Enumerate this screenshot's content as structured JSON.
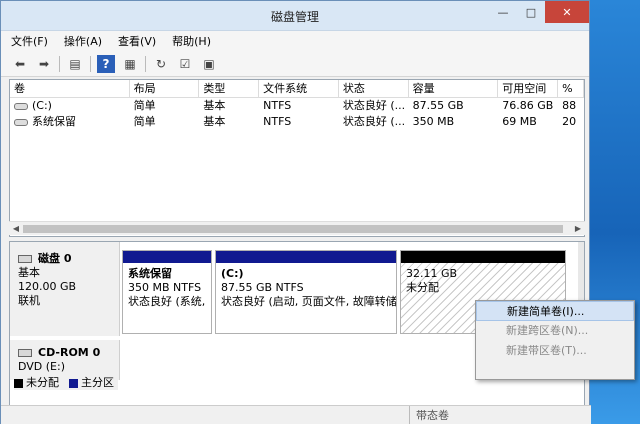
{
  "window": {
    "title": "磁盘管理"
  },
  "window_buttons": {
    "minimize": "—",
    "maximize": "□",
    "close": "✕"
  },
  "menu": [
    "文件(F)",
    "操作(A)",
    "查看(V)",
    "帮助(H)"
  ],
  "toolbar_icons": [
    "back-arrow-icon",
    "forward-arrow-icon",
    "list-view-icon",
    "help-icon",
    "properties-icon",
    "refresh-icon",
    "export-icon",
    "settings-icon"
  ],
  "volume_list": {
    "columns": [
      "卷",
      "布局",
      "类型",
      "文件系统",
      "状态",
      "容量",
      "可用空间",
      "%"
    ],
    "rows": [
      [
        "(C:)",
        "简单",
        "基本",
        "NTFS",
        "状态良好 (...",
        "87.55 GB",
        "76.86 GB",
        "88"
      ],
      [
        "系统保留",
        "简单",
        "基本",
        "NTFS",
        "状态良好 (...",
        "350 MB",
        "69 MB",
        "20"
      ]
    ]
  },
  "disk0": {
    "name": "磁盘 0",
    "type": "基本",
    "size": "120.00 GB",
    "status": "联机",
    "partitions": [
      {
        "name": "系统保留",
        "size": "350 MB NTFS",
        "status": "状态良好 (系统,",
        "color": "#101990"
      },
      {
        "name": "(C:)",
        "size": "87.55 GB NTFS",
        "status": "状态良好 (启动, 页面文件, 故障转储",
        "color": "#101990"
      },
      {
        "name": "",
        "size": "32.11 GB",
        "status": "未分配",
        "color": "#000000"
      }
    ]
  },
  "cdrom": {
    "name": "CD-ROM 0",
    "type": "DVD (E:)"
  },
  "legend": [
    {
      "label": "未分配",
      "color": "#000000"
    },
    {
      "label": "主分区",
      "color": "#101990"
    }
  ],
  "context_menu": [
    {
      "label": "新建简单卷(I)...",
      "enabled": true
    },
    {
      "label": "新建跨区卷(N)...",
      "enabled": false
    },
    {
      "label": "新建带区卷(T)...",
      "enabled": false
    }
  ],
  "statusbar": {
    "text": "带态卷"
  }
}
